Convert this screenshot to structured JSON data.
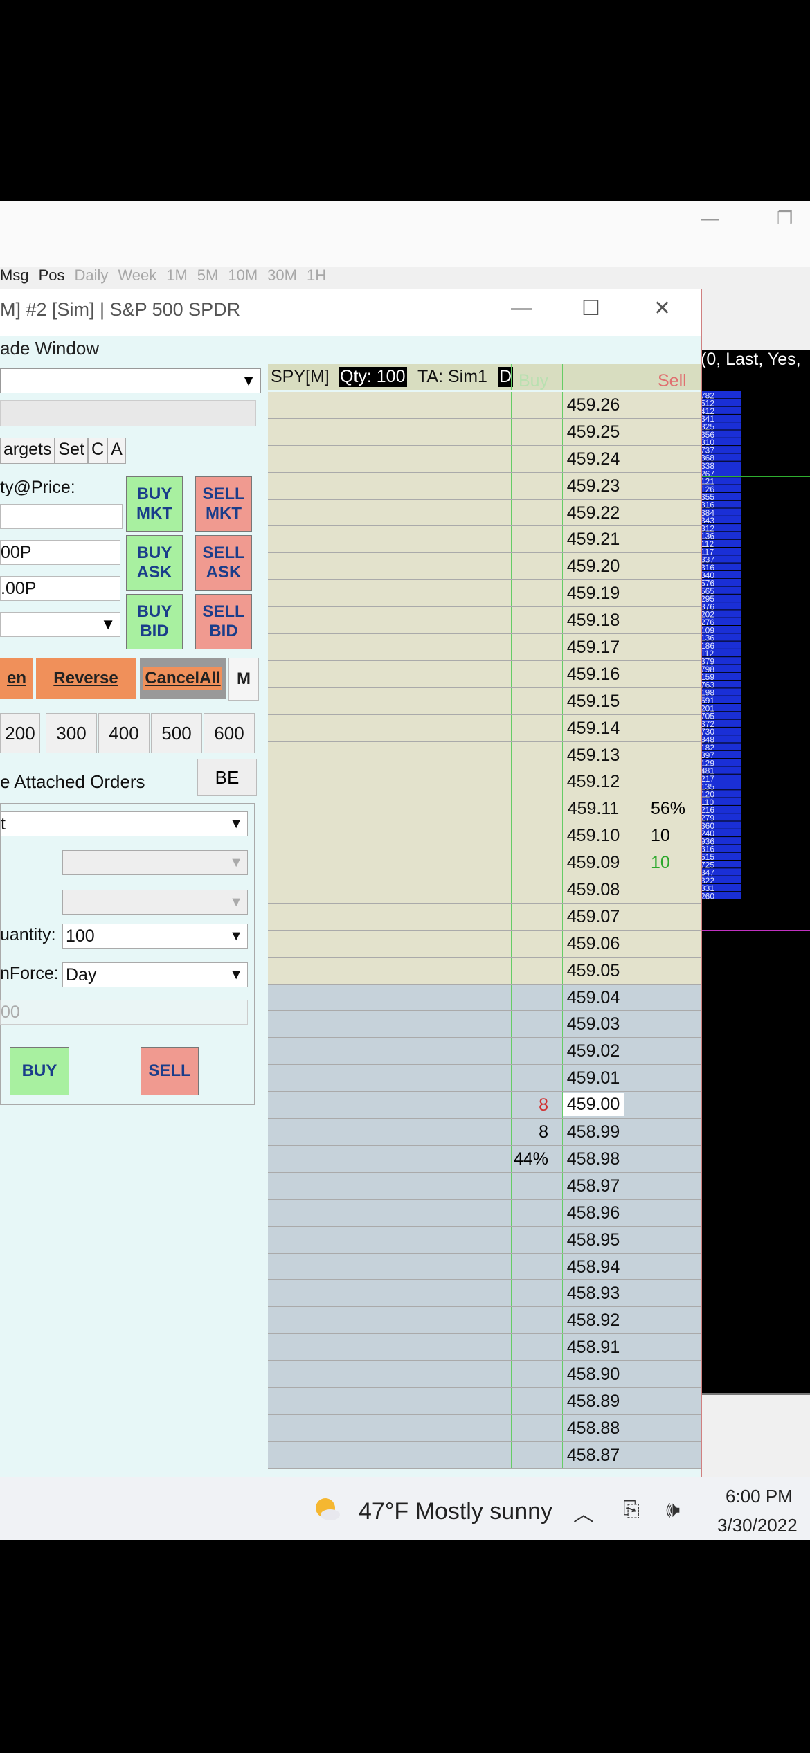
{
  "outer": {
    "tabs": [
      "Msg",
      "Pos",
      "Daily",
      "Week",
      "1M",
      "5M",
      "10M",
      "30M",
      "1H"
    ],
    "minimize": "—",
    "restore": "❐"
  },
  "chart": {
    "header": "(0, Last, Yes,",
    "volume_bars": [
      782,
      512,
      412,
      341,
      325,
      356,
      310,
      737,
      368,
      338,
      267,
      121,
      126,
      355,
      316,
      384,
      343,
      312,
      136,
      112,
      117,
      337,
      316,
      340,
      576,
      565,
      295,
      376,
      202,
      276,
      109,
      136,
      186,
      112,
      379,
      798,
      159,
      763,
      198,
      591,
      201,
      705,
      372,
      730,
      848,
      182,
      397,
      129,
      481,
      217,
      135,
      120,
      110,
      216,
      279,
      360,
      240,
      936,
      316,
      515,
      725,
      347,
      322,
      331,
      260
    ]
  },
  "dialog": {
    "title": "M]  #2 [Sim]  | S&P 500 SPDR",
    "minimize": "—",
    "maximize": "☐",
    "close": "✕",
    "menu": "ade  Window"
  },
  "left_panel": {
    "tabs": [
      "argets",
      "Set",
      "C",
      "A"
    ],
    "qty_price_label": "ty@Price:",
    "price1": "00P",
    "price2": ".00P",
    "buttons": {
      "buy_mkt": "BUY\nMKT",
      "sell_mkt": "SELL\nMKT",
      "buy_ask": "BUY\nASK",
      "sell_ask": "SELL\nASK",
      "buy_bid": "BUY\nBID",
      "sell_bid": "SELL\nBID"
    },
    "order_buttons": {
      "en": "en",
      "reverse": "Reverse",
      "cancel_all": "CancelAll",
      "m": "M"
    },
    "qty_buttons": [
      "200",
      "300",
      "400",
      "500",
      "600"
    ],
    "attached_label": "e Attached Orders",
    "be": "BE",
    "combo_top": "t",
    "quantity_label": "uantity:",
    "quantity_value": "100",
    "tif_label": "nForce:",
    "tif_value": "Day",
    "disabled_value": "00",
    "buy": "BUY",
    "sell": "SELL"
  },
  "dom": {
    "symbol": "SPY[M]",
    "qty": "Qty: 100",
    "ta": "TA: Sim1",
    "d": "D",
    "buy_header": "Buy",
    "sell_header": "Sell",
    "rows": [
      {
        "price": "459.26",
        "bid": "",
        "ask": "",
        "side": "ask"
      },
      {
        "price": "459.25",
        "bid": "",
        "ask": "",
        "side": "ask"
      },
      {
        "price": "459.24",
        "bid": "",
        "ask": "",
        "side": "ask"
      },
      {
        "price": "459.23",
        "bid": "",
        "ask": "",
        "side": "ask"
      },
      {
        "price": "459.22",
        "bid": "",
        "ask": "",
        "side": "ask"
      },
      {
        "price": "459.21",
        "bid": "",
        "ask": "",
        "side": "ask"
      },
      {
        "price": "459.20",
        "bid": "",
        "ask": "",
        "side": "ask"
      },
      {
        "price": "459.19",
        "bid": "",
        "ask": "",
        "side": "ask"
      },
      {
        "price": "459.18",
        "bid": "",
        "ask": "",
        "side": "ask"
      },
      {
        "price": "459.17",
        "bid": "",
        "ask": "",
        "side": "ask"
      },
      {
        "price": "459.16",
        "bid": "",
        "ask": "",
        "side": "ask"
      },
      {
        "price": "459.15",
        "bid": "",
        "ask": "",
        "side": "ask"
      },
      {
        "price": "459.14",
        "bid": "",
        "ask": "",
        "side": "ask"
      },
      {
        "price": "459.13",
        "bid": "",
        "ask": "",
        "side": "ask"
      },
      {
        "price": "459.12",
        "bid": "",
        "ask": "",
        "side": "ask"
      },
      {
        "price": "459.11",
        "bid": "",
        "ask": "56%",
        "side": "ask"
      },
      {
        "price": "459.10",
        "bid": "",
        "ask": "10",
        "side": "ask"
      },
      {
        "price": "459.09",
        "bid": "",
        "ask": "10",
        "side": "ask",
        "ask_color": "#2aa82a"
      },
      {
        "price": "459.08",
        "bid": "",
        "ask": "",
        "side": "ask"
      },
      {
        "price": "459.07",
        "bid": "",
        "ask": "",
        "side": "ask"
      },
      {
        "price": "459.06",
        "bid": "",
        "ask": "",
        "side": "ask"
      },
      {
        "price": "459.05",
        "bid": "",
        "ask": "",
        "side": "ask"
      },
      {
        "price": "459.04",
        "bid": "",
        "ask": "",
        "side": "bid"
      },
      {
        "price": "459.03",
        "bid": "",
        "ask": "",
        "side": "bid"
      },
      {
        "price": "459.02",
        "bid": "",
        "ask": "",
        "side": "bid"
      },
      {
        "price": "459.01",
        "bid": "",
        "ask": "",
        "side": "bid"
      },
      {
        "price": "459.00",
        "bid": "8",
        "ask": "",
        "side": "bid",
        "bid_color": "#d03030",
        "current": true
      },
      {
        "price": "458.99",
        "bid": "8",
        "ask": "",
        "side": "bid"
      },
      {
        "price": "458.98",
        "bid": "44%",
        "ask": "",
        "side": "bid"
      },
      {
        "price": "458.97",
        "bid": "",
        "ask": "",
        "side": "bid"
      },
      {
        "price": "458.96",
        "bid": "",
        "ask": "",
        "side": "bid"
      },
      {
        "price": "458.95",
        "bid": "",
        "ask": "",
        "side": "bid"
      },
      {
        "price": "458.94",
        "bid": "",
        "ask": "",
        "side": "bid"
      },
      {
        "price": "458.93",
        "bid": "",
        "ask": "",
        "side": "bid"
      },
      {
        "price": "458.92",
        "bid": "",
        "ask": "",
        "side": "bid"
      },
      {
        "price": "458.91",
        "bid": "",
        "ask": "",
        "side": "bid"
      },
      {
        "price": "458.90",
        "bid": "",
        "ask": "",
        "side": "bid"
      },
      {
        "price": "458.89",
        "bid": "",
        "ask": "",
        "side": "bid"
      },
      {
        "price": "458.88",
        "bid": "",
        "ask": "",
        "side": "bid"
      },
      {
        "price": "458.87",
        "bid": "",
        "ask": "",
        "side": "bid"
      }
    ]
  },
  "taskbar": {
    "weather": "47°F  Mostly sunny",
    "time": "6:00 PM",
    "date": "3/30/2022"
  },
  "colors": {
    "buy_green": "#a8f0a0",
    "sell_red": "#f09a90",
    "orange": "#f0905a"
  }
}
